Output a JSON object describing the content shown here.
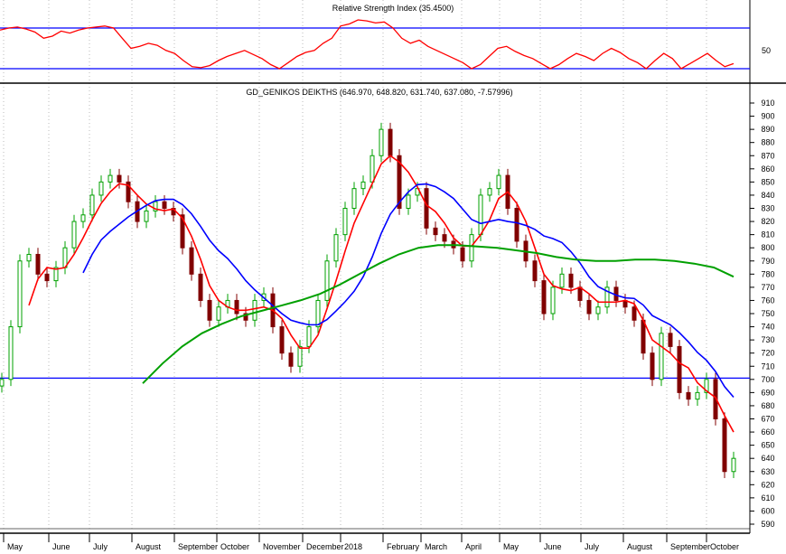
{
  "chart_data": [
    {
      "type": "line",
      "title": "Relative Strength Index (35.4500)",
      "ylabel_tick": "50",
      "reference_lines": [
        70,
        30
      ],
      "ylim": [
        0,
        100
      ],
      "values": [
        68,
        70,
        71,
        69,
        66,
        60,
        62,
        67,
        65,
        68,
        70,
        71,
        72,
        70,
        60,
        50,
        52,
        55,
        53,
        48,
        45,
        38,
        32,
        31,
        33,
        38,
        42,
        45,
        48,
        44,
        40,
        34,
        30,
        36,
        42,
        46,
        48,
        55,
        60,
        72,
        74,
        78,
        77,
        75,
        76,
        70,
        60,
        55,
        58,
        52,
        48,
        44,
        40,
        36,
        30,
        34,
        42,
        50,
        52,
        47,
        43,
        40,
        35,
        30,
        34,
        40,
        45,
        42,
        38,
        45,
        50,
        46,
        40,
        36,
        30,
        38,
        45,
        40,
        30,
        35,
        40,
        45,
        38,
        32,
        35
      ],
      "color": "#ff0000"
    },
    {
      "type": "candlestick",
      "title": "GD_GENIKOS DEIKTHS (646.970, 648.820, 631.740, 637.080, -7.57996)",
      "x_labels": [
        "May",
        "June",
        "July",
        "August",
        "September",
        "October",
        "November",
        "December",
        "2018",
        "February",
        "March",
        "April",
        "May",
        "June",
        "July",
        "August",
        "September",
        "October"
      ],
      "ylim": [
        585,
        915
      ],
      "yticks": [
        910,
        900,
        890,
        880,
        870,
        860,
        850,
        840,
        830,
        820,
        810,
        800,
        790,
        780,
        770,
        760,
        750,
        740,
        730,
        720,
        710,
        700,
        690,
        680,
        670,
        660,
        650,
        640,
        630,
        620,
        610,
        600,
        590
      ],
      "reference_line": 701,
      "closes": [
        700,
        740,
        790,
        795,
        780,
        775,
        785,
        800,
        820,
        825,
        840,
        850,
        855,
        850,
        835,
        820,
        828,
        835,
        830,
        825,
        800,
        780,
        760,
        745,
        755,
        760,
        750,
        745,
        760,
        765,
        740,
        720,
        710,
        725,
        740,
        760,
        790,
        810,
        830,
        845,
        850,
        870,
        890,
        870,
        830,
        840,
        845,
        815,
        810,
        805,
        800,
        790,
        810,
        840,
        845,
        855,
        830,
        805,
        790,
        775,
        750,
        770,
        780,
        770,
        760,
        750,
        755,
        770,
        760,
        755,
        745,
        720,
        700,
        735,
        725,
        690,
        685,
        690,
        700,
        670,
        630,
        640
      ],
      "ma_short": {
        "name": "MA short",
        "color": "#ff0000",
        "window": 4
      },
      "ma_mid": {
        "name": "MA mid",
        "color": "#0000ff",
        "window": 10
      },
      "ma_long": {
        "name": "MA long",
        "color": "#00a000",
        "values": [
          697,
          712,
          725,
          735,
          742,
          748,
          752,
          756,
          760,
          765,
          772,
          780,
          788,
          795,
          800,
          802,
          802,
          801,
          800,
          798,
          796,
          793,
          791,
          790,
          790,
          791,
          791,
          790,
          788,
          785,
          778
        ]
      }
    }
  ]
}
